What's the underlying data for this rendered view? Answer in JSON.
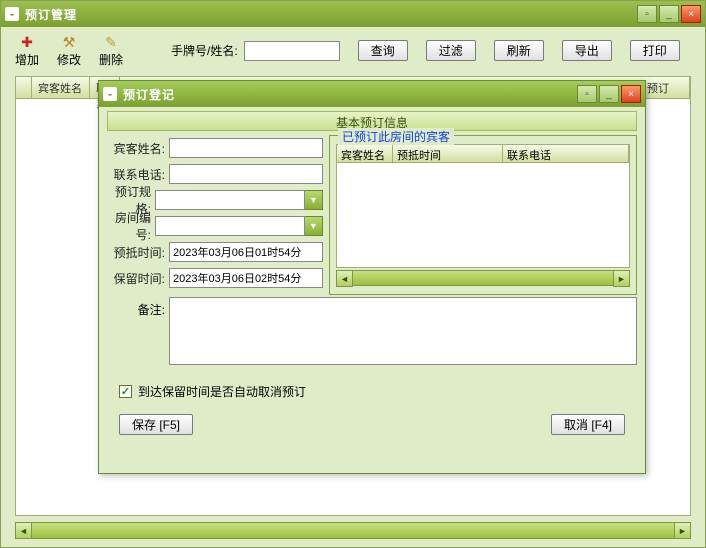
{
  "main": {
    "title": "预订管理",
    "toolbar": {
      "add": "增加",
      "edit": "修改",
      "del": "删除",
      "search_label": "手牌号/姓名:",
      "search_value": "",
      "query": "查询",
      "filter": "过滤",
      "refresh": "刷新",
      "export": "导出",
      "print": "打印"
    },
    "grid_headers": {
      "h1": "宾客姓名",
      "h2": "联系",
      "rest": "预订"
    }
  },
  "dialog": {
    "title": "预订登记",
    "section": "基本预订信息",
    "form": {
      "guest_name_label": "宾客姓名:",
      "guest_name": "",
      "phone_label": "联系电话:",
      "phone": "",
      "spec_label": "预订规格:",
      "spec": "",
      "room_label": "房间编号:",
      "room": "",
      "arrive_label": "预抵时间:",
      "arrive": "2023年03月06日01时54分",
      "hold_label": "保留时间:",
      "hold": "2023年03月06日02时54分",
      "remark_label": "备注:",
      "remark": ""
    },
    "booked_box": {
      "legend": "已预订此房间的宾客",
      "h0": "宾客姓名",
      "h1": "预抵时间",
      "h2": "联系电话"
    },
    "auto_cancel": "到达保留时间是否自动取消预订",
    "save": "保存 [F5]",
    "cancel": "取消 [F4]"
  }
}
